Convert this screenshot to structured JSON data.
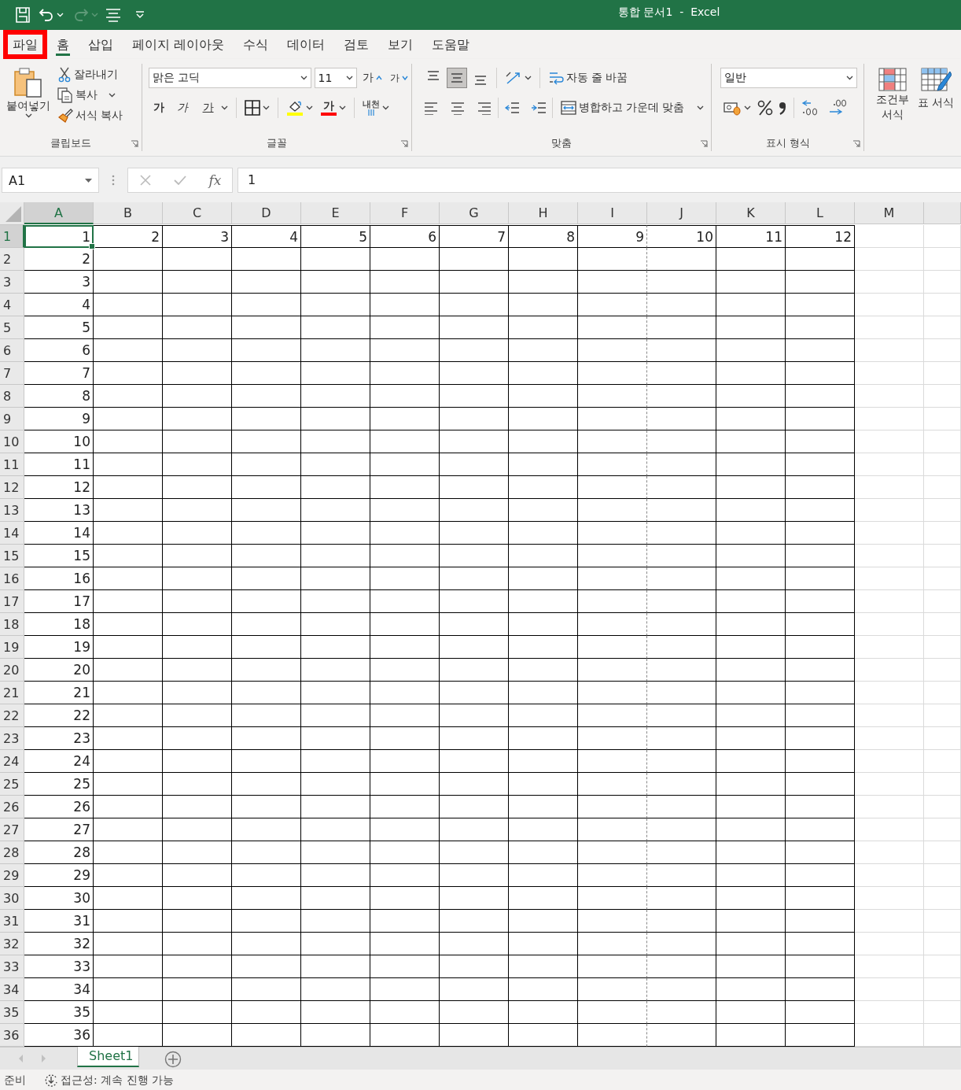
{
  "window": {
    "title": "통합 문서1  -  Excel"
  },
  "tabs": [
    {
      "label": "파일",
      "selected": false,
      "highlighted": true
    },
    {
      "label": "홈",
      "selected": true,
      "highlighted": false
    },
    {
      "label": "삽입",
      "selected": false,
      "highlighted": false
    },
    {
      "label": "페이지 레이아웃",
      "selected": false,
      "highlighted": false
    },
    {
      "label": "수식",
      "selected": false,
      "highlighted": false
    },
    {
      "label": "데이터",
      "selected": false,
      "highlighted": false
    },
    {
      "label": "검토",
      "selected": false,
      "highlighted": false
    },
    {
      "label": "보기",
      "selected": false,
      "highlighted": false
    },
    {
      "label": "도움말",
      "selected": false,
      "highlighted": false
    }
  ],
  "ribbon": {
    "clipboard": {
      "label": "클립보드",
      "paste": "붙여넣기",
      "cut": "잘라내기",
      "copy": "복사",
      "format_painter": "서식 복사"
    },
    "font": {
      "label": "글꼴",
      "font_name": "맑은 고딕",
      "font_size": "11",
      "grow": "가",
      "shrink": "가",
      "bold": "가",
      "italic": "가",
      "underline": "가",
      "font_color": "가",
      "phonetic": "내천"
    },
    "alignment": {
      "label": "맞춤",
      "vertical": [
        {
          "kind": "top",
          "selected": false
        },
        {
          "kind": "middle",
          "selected": true
        },
        {
          "kind": "bottom",
          "selected": false
        }
      ],
      "wrap_text": "자동 줄 바꿈",
      "merge": "병합하고 가운데 맞춤"
    },
    "number": {
      "label": "표시 형식",
      "format": "일반"
    },
    "styles": {
      "conditional": "조건부 서식",
      "table": "표 서식"
    }
  },
  "formula_bar": {
    "name_box": "A1",
    "function_label": "fx",
    "value": "1"
  },
  "columns": [
    {
      "label": "A",
      "selected": true,
      "bordered": true,
      "page_break": false
    },
    {
      "label": "B",
      "selected": false,
      "bordered": true,
      "page_break": false
    },
    {
      "label": "C",
      "selected": false,
      "bordered": true,
      "page_break": false
    },
    {
      "label": "D",
      "selected": false,
      "bordered": true,
      "page_break": false
    },
    {
      "label": "E",
      "selected": false,
      "bordered": true,
      "page_break": false
    },
    {
      "label": "F",
      "selected": false,
      "bordered": true,
      "page_break": false
    },
    {
      "label": "G",
      "selected": false,
      "bordered": true,
      "page_break": false
    },
    {
      "label": "H",
      "selected": false,
      "bordered": true,
      "page_break": false
    },
    {
      "label": "I",
      "selected": false,
      "bordered": true,
      "page_break": true
    },
    {
      "label": "J",
      "selected": false,
      "bordered": true,
      "page_break": false
    },
    {
      "label": "K",
      "selected": false,
      "bordered": true,
      "page_break": false
    },
    {
      "label": "L",
      "selected": false,
      "bordered": true,
      "page_break": false
    },
    {
      "label": "M",
      "selected": false,
      "bordered": false,
      "page_break": false
    }
  ],
  "rows": [
    {
      "header": "1",
      "selected": true,
      "cells": [
        "1",
        "2",
        "3",
        "4",
        "5",
        "6",
        "7",
        "8",
        "9",
        "10",
        "11",
        "12"
      ]
    },
    {
      "header": "2",
      "selected": false,
      "cells": [
        "2"
      ]
    },
    {
      "header": "3",
      "selected": false,
      "cells": [
        "3"
      ]
    },
    {
      "header": "4",
      "selected": false,
      "cells": [
        "4"
      ]
    },
    {
      "header": "5",
      "selected": false,
      "cells": [
        "5"
      ]
    },
    {
      "header": "6",
      "selected": false,
      "cells": [
        "6"
      ]
    },
    {
      "header": "7",
      "selected": false,
      "cells": [
        "7"
      ]
    },
    {
      "header": "8",
      "selected": false,
      "cells": [
        "8"
      ]
    },
    {
      "header": "9",
      "selected": false,
      "cells": [
        "9"
      ]
    },
    {
      "header": "10",
      "selected": false,
      "cells": [
        "10"
      ]
    },
    {
      "header": "11",
      "selected": false,
      "cells": [
        "11"
      ]
    },
    {
      "header": "12",
      "selected": false,
      "cells": [
        "12"
      ]
    },
    {
      "header": "13",
      "selected": false,
      "cells": [
        "13"
      ]
    },
    {
      "header": "14",
      "selected": false,
      "cells": [
        "14"
      ]
    },
    {
      "header": "15",
      "selected": false,
      "cells": [
        "15"
      ]
    },
    {
      "header": "16",
      "selected": false,
      "cells": [
        "16"
      ]
    },
    {
      "header": "17",
      "selected": false,
      "cells": [
        "17"
      ]
    },
    {
      "header": "18",
      "selected": false,
      "cells": [
        "18"
      ]
    },
    {
      "header": "19",
      "selected": false,
      "cells": [
        "19"
      ]
    },
    {
      "header": "20",
      "selected": false,
      "cells": [
        "20"
      ]
    },
    {
      "header": "21",
      "selected": false,
      "cells": [
        "21"
      ]
    },
    {
      "header": "22",
      "selected": false,
      "cells": [
        "22"
      ]
    },
    {
      "header": "23",
      "selected": false,
      "cells": [
        "23"
      ]
    },
    {
      "header": "24",
      "selected": false,
      "cells": [
        "24"
      ]
    },
    {
      "header": "25",
      "selected": false,
      "cells": [
        "25"
      ]
    },
    {
      "header": "26",
      "selected": false,
      "cells": [
        "26"
      ]
    },
    {
      "header": "27",
      "selected": false,
      "cells": [
        "27"
      ]
    },
    {
      "header": "28",
      "selected": false,
      "cells": [
        "28"
      ]
    },
    {
      "header": "29",
      "selected": false,
      "cells": [
        "29"
      ]
    },
    {
      "header": "30",
      "selected": false,
      "cells": [
        "30"
      ]
    },
    {
      "header": "31",
      "selected": false,
      "cells": [
        "31"
      ]
    },
    {
      "header": "32",
      "selected": false,
      "cells": [
        "32"
      ]
    },
    {
      "header": "33",
      "selected": false,
      "cells": [
        "33"
      ]
    },
    {
      "header": "34",
      "selected": false,
      "cells": [
        "34"
      ]
    },
    {
      "header": "35",
      "selected": false,
      "cells": [
        "35"
      ]
    },
    {
      "header": "36",
      "selected": false,
      "cells": [
        "36"
      ]
    }
  ],
  "sheets": [
    {
      "name": "Sheet1",
      "selected": true
    }
  ],
  "status_bar": {
    "mode": "준비",
    "accessibility": "접근성: 계속 진행 가능"
  }
}
